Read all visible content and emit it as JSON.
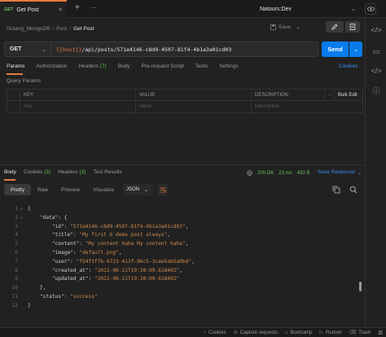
{
  "tabs": {
    "active": {
      "method": "GET",
      "title": "Get Post"
    },
    "add_label": "+",
    "more_label": "···"
  },
  "environment": {
    "name": "Natours:Dev"
  },
  "breadcrumb": [
    "Golang_MongoDB",
    "Post",
    "Get Post"
  ],
  "toolbar": {
    "save_label": "Save"
  },
  "request": {
    "method": "GET",
    "url_var": "{{host}}",
    "url_path": "/api/posts/571e4146-c8d9-4507-81f4-4b1a3a01cd03",
    "send_label": "Send"
  },
  "request_tabs": [
    {
      "label": "Params"
    },
    {
      "label": "Authorization"
    },
    {
      "label": "Headers",
      "count": "(7)"
    },
    {
      "label": "Body"
    },
    {
      "label": "Pre-request Script"
    },
    {
      "label": "Tests"
    },
    {
      "label": "Settings"
    }
  ],
  "cookies_label": "Cookies",
  "query_params": {
    "title": "Query Params",
    "headers": [
      "KEY",
      "VALUE",
      "DESCRIPTION"
    ],
    "bulk_edit": "Bulk Edit",
    "placeholders": [
      "Key",
      "Value",
      "Description"
    ]
  },
  "response": {
    "tabs": [
      {
        "label": "Body"
      },
      {
        "label": "Cookies",
        "count": "(3)"
      },
      {
        "label": "Headers",
        "count": "(3)"
      },
      {
        "label": "Test Results"
      }
    ],
    "status": "200 OK",
    "time": "23 ms",
    "size": "433 B",
    "save_label": "Save Response",
    "views": [
      "Pretty",
      "Raw",
      "Preview",
      "Visualize"
    ],
    "format": "JSON",
    "lines": [
      {
        "n": "1",
        "fold": "▾",
        "parts": [
          [
            "p",
            "{"
          ]
        ]
      },
      {
        "n": "2",
        "fold": "▾",
        "parts": [
          [
            "p",
            "    "
          ],
          [
            "k",
            "\"data\""
          ],
          [
            "p",
            ": {"
          ]
        ]
      },
      {
        "n": "3",
        "parts": [
          [
            "p",
            "        "
          ],
          [
            "k",
            "\"id\""
          ],
          [
            "p",
            ": "
          ],
          [
            "s",
            "\"571e4146-c8d9-4507-81f4-4b1a3a01cd03\""
          ],
          [
            "p",
            ","
          ]
        ]
      },
      {
        "n": "4",
        "parts": [
          [
            "p",
            "        "
          ],
          [
            "k",
            "\"title\""
          ],
          [
            "p",
            ": "
          ],
          [
            "s",
            "\"My first 6 demo post always\""
          ],
          [
            "p",
            ","
          ]
        ]
      },
      {
        "n": "5",
        "parts": [
          [
            "p",
            "        "
          ],
          [
            "k",
            "\"content\""
          ],
          [
            "p",
            ": "
          ],
          [
            "s",
            "\"My content haha My content haha\""
          ],
          [
            "p",
            ","
          ]
        ]
      },
      {
        "n": "6",
        "parts": [
          [
            "p",
            "        "
          ],
          [
            "k",
            "\"image\""
          ],
          [
            "p",
            ": "
          ],
          [
            "s",
            "\"default.png\""
          ],
          [
            "p",
            ","
          ]
        ]
      },
      {
        "n": "7",
        "parts": [
          [
            "p",
            "        "
          ],
          [
            "k",
            "\"user\""
          ],
          [
            "p",
            ": "
          ],
          [
            "s",
            "\"f54f1f7b-6723-411f-86c5-3cee5ab5a0bd\""
          ],
          [
            "p",
            ","
          ]
        ]
      },
      {
        "n": "8",
        "parts": [
          [
            "p",
            "        "
          ],
          [
            "k",
            "\"created_at\""
          ],
          [
            "p",
            ": "
          ],
          [
            "s",
            "\"2022-08-21T19:38:09.61840Z\""
          ],
          [
            "p",
            ","
          ]
        ]
      },
      {
        "n": "9",
        "parts": [
          [
            "p",
            "        "
          ],
          [
            "k",
            "\"updated_at\""
          ],
          [
            "p",
            ": "
          ],
          [
            "s",
            "\"2022-08-21T19:38:09.61840Z\""
          ]
        ]
      },
      {
        "n": "10",
        "parts": [
          [
            "p",
            "    },"
          ]
        ]
      },
      {
        "n": "11",
        "parts": [
          [
            "p",
            "    "
          ],
          [
            "k",
            "\"status\""
          ],
          [
            "p",
            ": "
          ],
          [
            "s",
            "\"success\""
          ]
        ]
      },
      {
        "n": "12",
        "parts": [
          [
            "p",
            "}"
          ]
        ]
      }
    ]
  },
  "footer": [
    "Cookies",
    "Capture requests",
    "Bootcamp",
    "Runner",
    "Trash"
  ],
  "colors": {
    "accent": "#e5793f",
    "send_blue": "#097bed",
    "link_blue": "#3d8ef0",
    "success_green": "#6ec15b",
    "json_string": "#d08a4d",
    "background": "#212121"
  }
}
